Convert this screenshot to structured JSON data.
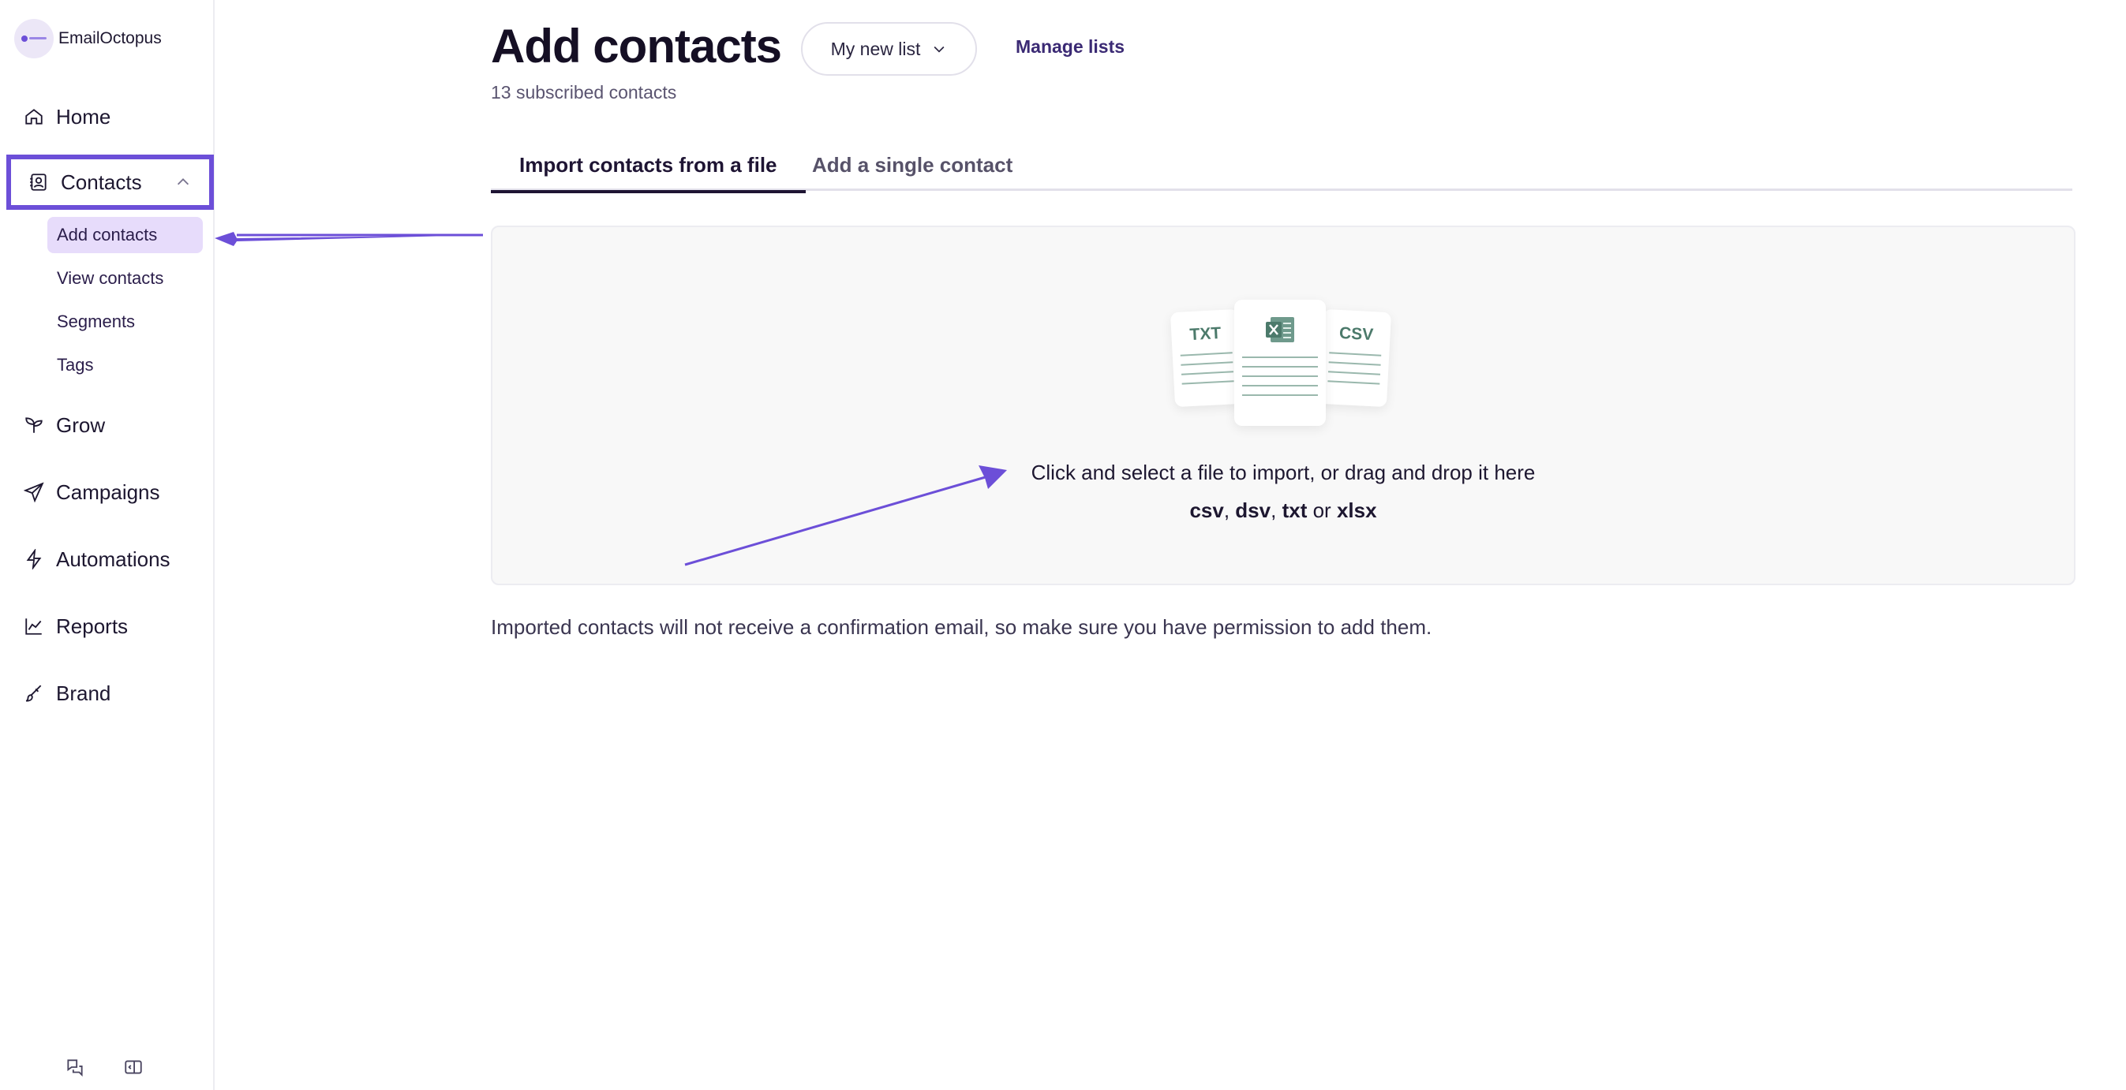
{
  "brand": {
    "name": "EmailOctopus",
    "logo_icon": "octopus-logo-icon"
  },
  "sidebar": {
    "items": [
      {
        "label": "Home",
        "icon": "home-icon"
      },
      {
        "label": "Contacts",
        "icon": "contacts-icon"
      },
      {
        "label": "Grow",
        "icon": "sprout-icon"
      },
      {
        "label": "Campaigns",
        "icon": "send-icon"
      },
      {
        "label": "Automations",
        "icon": "lightning-icon"
      },
      {
        "label": "Reports",
        "icon": "chart-line-icon"
      },
      {
        "label": "Brand",
        "icon": "brush-icon"
      }
    ],
    "contacts_submenu": [
      {
        "label": "Add contacts",
        "active": true
      },
      {
        "label": "View contacts",
        "active": false
      },
      {
        "label": "Segments",
        "active": false
      },
      {
        "label": "Tags",
        "active": false
      }
    ],
    "footer_icons": [
      "help-chat-icon",
      "collapse-sidebar-icon"
    ]
  },
  "header": {
    "title": "Add contacts",
    "list_selector": "My new list",
    "manage_lists": "Manage lists",
    "subtitle": "13 subscribed contacts"
  },
  "tabs": [
    {
      "label": "Import contacts from a file",
      "active": true
    },
    {
      "label": "Add a single contact",
      "active": false
    }
  ],
  "dropzone": {
    "file_labels": [
      "TXT",
      "CSV"
    ],
    "instruction": "Click and select a file to import, or drag and drop it here",
    "formats": {
      "f1": "csv",
      "f2": "dsv",
      "f3": "txt",
      "f4": "xlsx",
      "sep": ",",
      "or": "or"
    }
  },
  "note": "Imported contacts will not receive a confirmation email, so make sure you have permission to add them.",
  "colors": {
    "accent": "#6c4fd8",
    "active_sub_bg": "#e7dcfb",
    "tab_active": "#1e1433",
    "file_green": "#4c7a6b"
  }
}
